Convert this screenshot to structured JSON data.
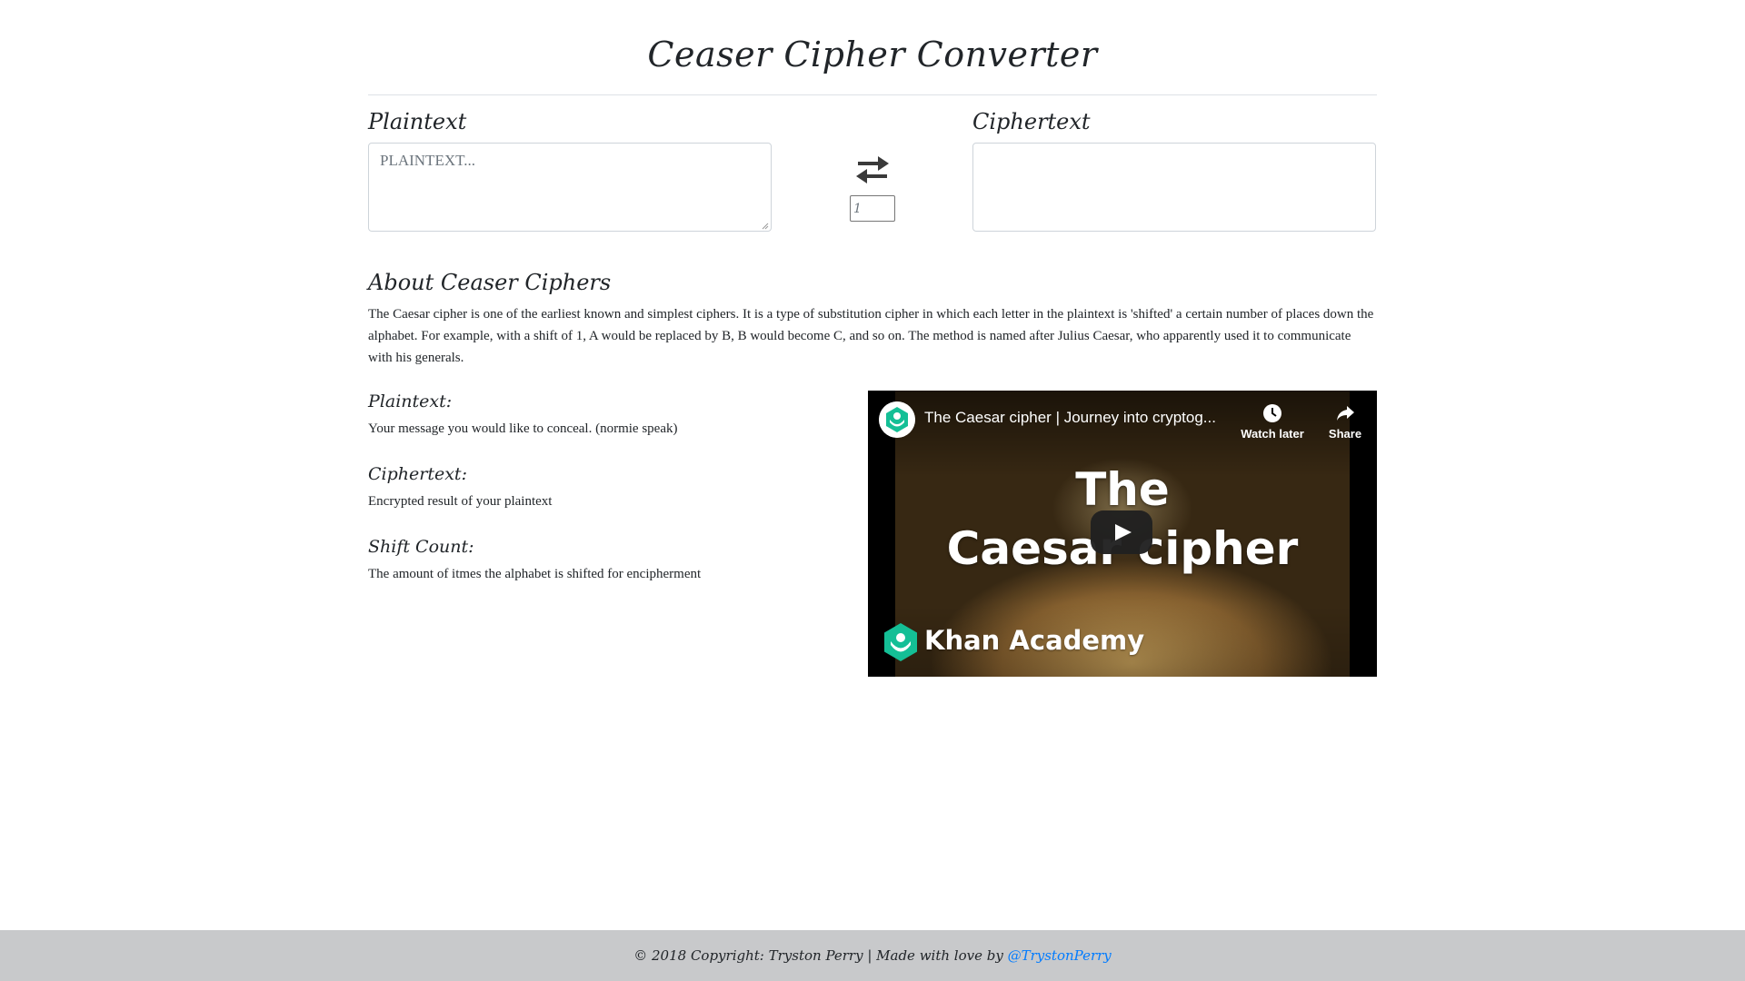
{
  "header": {
    "title": "Ceaser Cipher Converter"
  },
  "converter": {
    "plaintext_label": "Plaintext",
    "plaintext_placeholder": "PLAINTEXT...",
    "plaintext_value": "",
    "ciphertext_label": "Ciphertext",
    "ciphertext_value": "",
    "shift_value": "1",
    "swap_icon": "swap-arrows-icon"
  },
  "about": {
    "heading": "About Ceaser Ciphers",
    "text": "The Caesar cipher is one of the earliest known and simplest ciphers. It is a type of substitution cipher in which each letter in the plaintext is 'shifted' a certain number of places down the alphabet. For example, with a shift of 1, A would be replaced by B, B would become C, and so on. The method is named after Julius Caesar, who apparently used it to communicate with his generals.",
    "definitions": [
      {
        "term": "Plaintext:",
        "desc": "Your message you would like to conceal. (normie speak)"
      },
      {
        "term": "Ciphertext:",
        "desc": "Encrypted result of your plaintext"
      },
      {
        "term": "Shift Count:",
        "desc": "The amount of itmes the alphabet is shifted for encipherment"
      }
    ]
  },
  "video": {
    "title": "The Caesar cipher | Journey into cryptog...",
    "watch_later": "Watch later",
    "share": "Share",
    "thumb_line1": "The",
    "thumb_line2": "Caesar cipher",
    "brand": "Khan Academy",
    "accent": "#14bf96"
  },
  "footer": {
    "text": "© 2018 Copyright: Tryston Perry | Made with love by ",
    "link_text": "@TrystonPerry",
    "link_color": "#007bff",
    "bg_color": "#c8c9cb"
  }
}
